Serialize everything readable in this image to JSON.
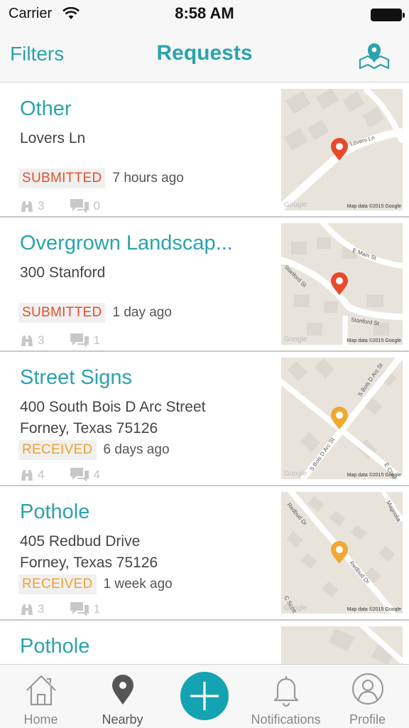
{
  "status_bar": {
    "carrier": "Carrier",
    "time": "8:58 AM"
  },
  "nav": {
    "left": "Filters",
    "title": "Requests",
    "right_icon": "map-pin-icon"
  },
  "colors": {
    "accent": "#2aa3ad",
    "submitted": "#e4502a",
    "received": "#f0a030",
    "pin_red": "#e9482b",
    "pin_orange": "#f0a830"
  },
  "requests": [
    {
      "title": "Other",
      "address1": "Lovers Ln",
      "address2": "",
      "status": "SUBMITTED",
      "time": "7 hours ago",
      "watchers": "3",
      "comments": "0",
      "map_labels": [
        "Lovers Ln"
      ],
      "credit": "Map data ©2015 Google",
      "google": "Google"
    },
    {
      "title": "Overgrown Landscap...",
      "address1": "300  Stanford",
      "address2": "",
      "status": "SUBMITTED",
      "time": "1 day ago",
      "watchers": "3",
      "comments": "1",
      "map_labels": [
        "E Main St",
        "Stanford St",
        "Stanford St"
      ],
      "credit": "Map data ©2015 Google",
      "google": "Google"
    },
    {
      "title": "Street Signs",
      "address1": "400  South Bois D Arc Street",
      "address2": "Forney, Texas 75126",
      "status": "RECEIVED",
      "time": "6 days ago",
      "watchers": "4",
      "comments": "4",
      "map_labels": [
        "S Bois D Arc St",
        "S Bois D Arc St",
        "E Chris"
      ],
      "credit": "Map data ©2015 Google",
      "google": "Google"
    },
    {
      "title": "Pothole",
      "address1": "405  Redbud Drive",
      "address2": "Forney, Texas 75126",
      "status": "RECEIVED",
      "time": "1 week ago",
      "watchers": "3",
      "comments": "1",
      "map_labels": [
        "Redbud Dr",
        "Redbud Dr",
        "Magnolia",
        "C Scott"
      ],
      "credit": "Map data ©2015 Google",
      "google": "Google"
    },
    {
      "title": "Pothole"
    }
  ],
  "tabs": [
    {
      "label": "Home",
      "icon": "home-icon"
    },
    {
      "label": "Nearby",
      "icon": "location-pin-icon"
    },
    {
      "label": "",
      "icon": "add-icon"
    },
    {
      "label": "Notifications",
      "icon": "bell-icon"
    },
    {
      "label": "Profile",
      "icon": "profile-icon"
    }
  ]
}
